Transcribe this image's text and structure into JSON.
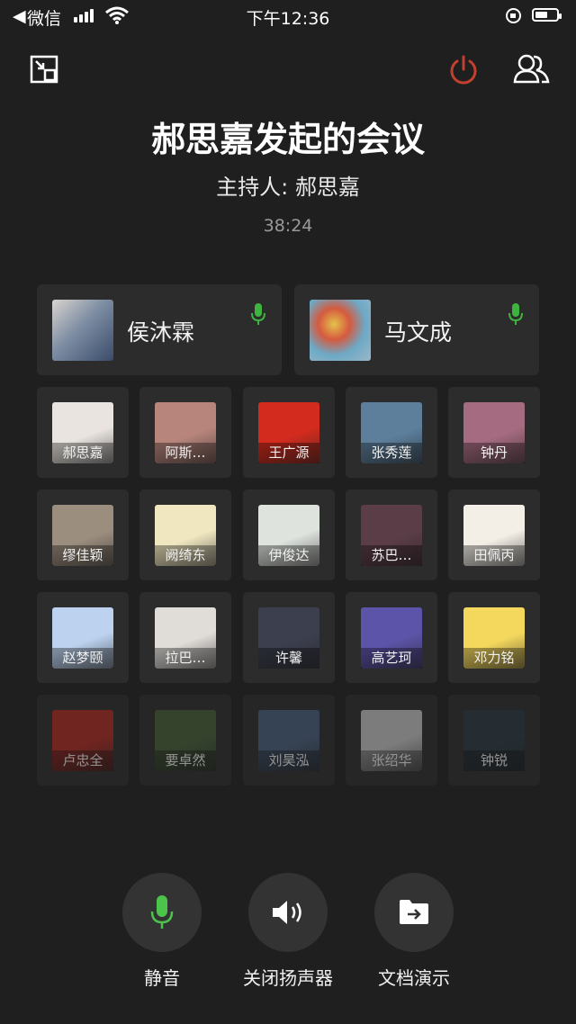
{
  "status_bar": {
    "back_arrow": "◀",
    "carrier": "微信",
    "time": "下午12:36"
  },
  "header": {
    "minimize_icon": "minimize-window-icon",
    "hangup_icon": "power-icon",
    "members_icon": "members-icon",
    "hangup_color": "#c2402f"
  },
  "meeting": {
    "title": "郝思嘉发起的会议",
    "host": "主持人: 郝思嘉",
    "duration": "38:24"
  },
  "speakers": [
    {
      "name": "侯沐霖",
      "mic": "on"
    },
    {
      "name": "马文成",
      "mic": "on"
    }
  ],
  "participants": [
    {
      "name": "郝思嘉",
      "color": "#e9e4df"
    },
    {
      "name": "阿斯…",
      "color": "#b7857c"
    },
    {
      "name": "王广源",
      "color": "#d32b1e"
    },
    {
      "name": "张秀莲",
      "color": "#5d7f9c"
    },
    {
      "name": "钟丹",
      "color": "#a56b80"
    },
    {
      "name": "缪佳颖",
      "color": "#9c8e7f"
    },
    {
      "name": "阙绮东",
      "color": "#f0e6c0"
    },
    {
      "name": "伊俊达",
      "color": "#dfe3de"
    },
    {
      "name": "苏巴…",
      "color": "#5b3d48"
    },
    {
      "name": "田佩丙",
      "color": "#f3eee6"
    },
    {
      "name": "赵梦颐",
      "color": "#bcd2ee"
    },
    {
      "name": "拉巴…",
      "color": "#e0dcd8"
    },
    {
      "name": "许馨",
      "color": "#3c3f4e"
    },
    {
      "name": "高艺珂",
      "color": "#5c54a8"
    },
    {
      "name": "邓力铭",
      "color": "#f4d85e"
    },
    {
      "name": "卢忠全",
      "color": "#b42a22"
    },
    {
      "name": "要卓然",
      "color": "#47613a"
    },
    {
      "name": "刘昊泓",
      "color": "#4a6180"
    },
    {
      "name": "张绍华",
      "color": "#c8c8c8"
    },
    {
      "name": "钟锐",
      "color": "#2a3a44"
    }
  ],
  "controls": [
    {
      "label": "静音",
      "icon": "microphone-icon",
      "color": "#4cc34a"
    },
    {
      "label": "关闭扬声器",
      "icon": "speaker-icon",
      "color": "#ffffff"
    },
    {
      "label": "文档演示",
      "icon": "folder-share-icon",
      "color": "#ffffff"
    }
  ],
  "accent": {
    "mic_green": "#3fb33f",
    "background": "#1f1f1f",
    "card": "#2c2c2c"
  }
}
